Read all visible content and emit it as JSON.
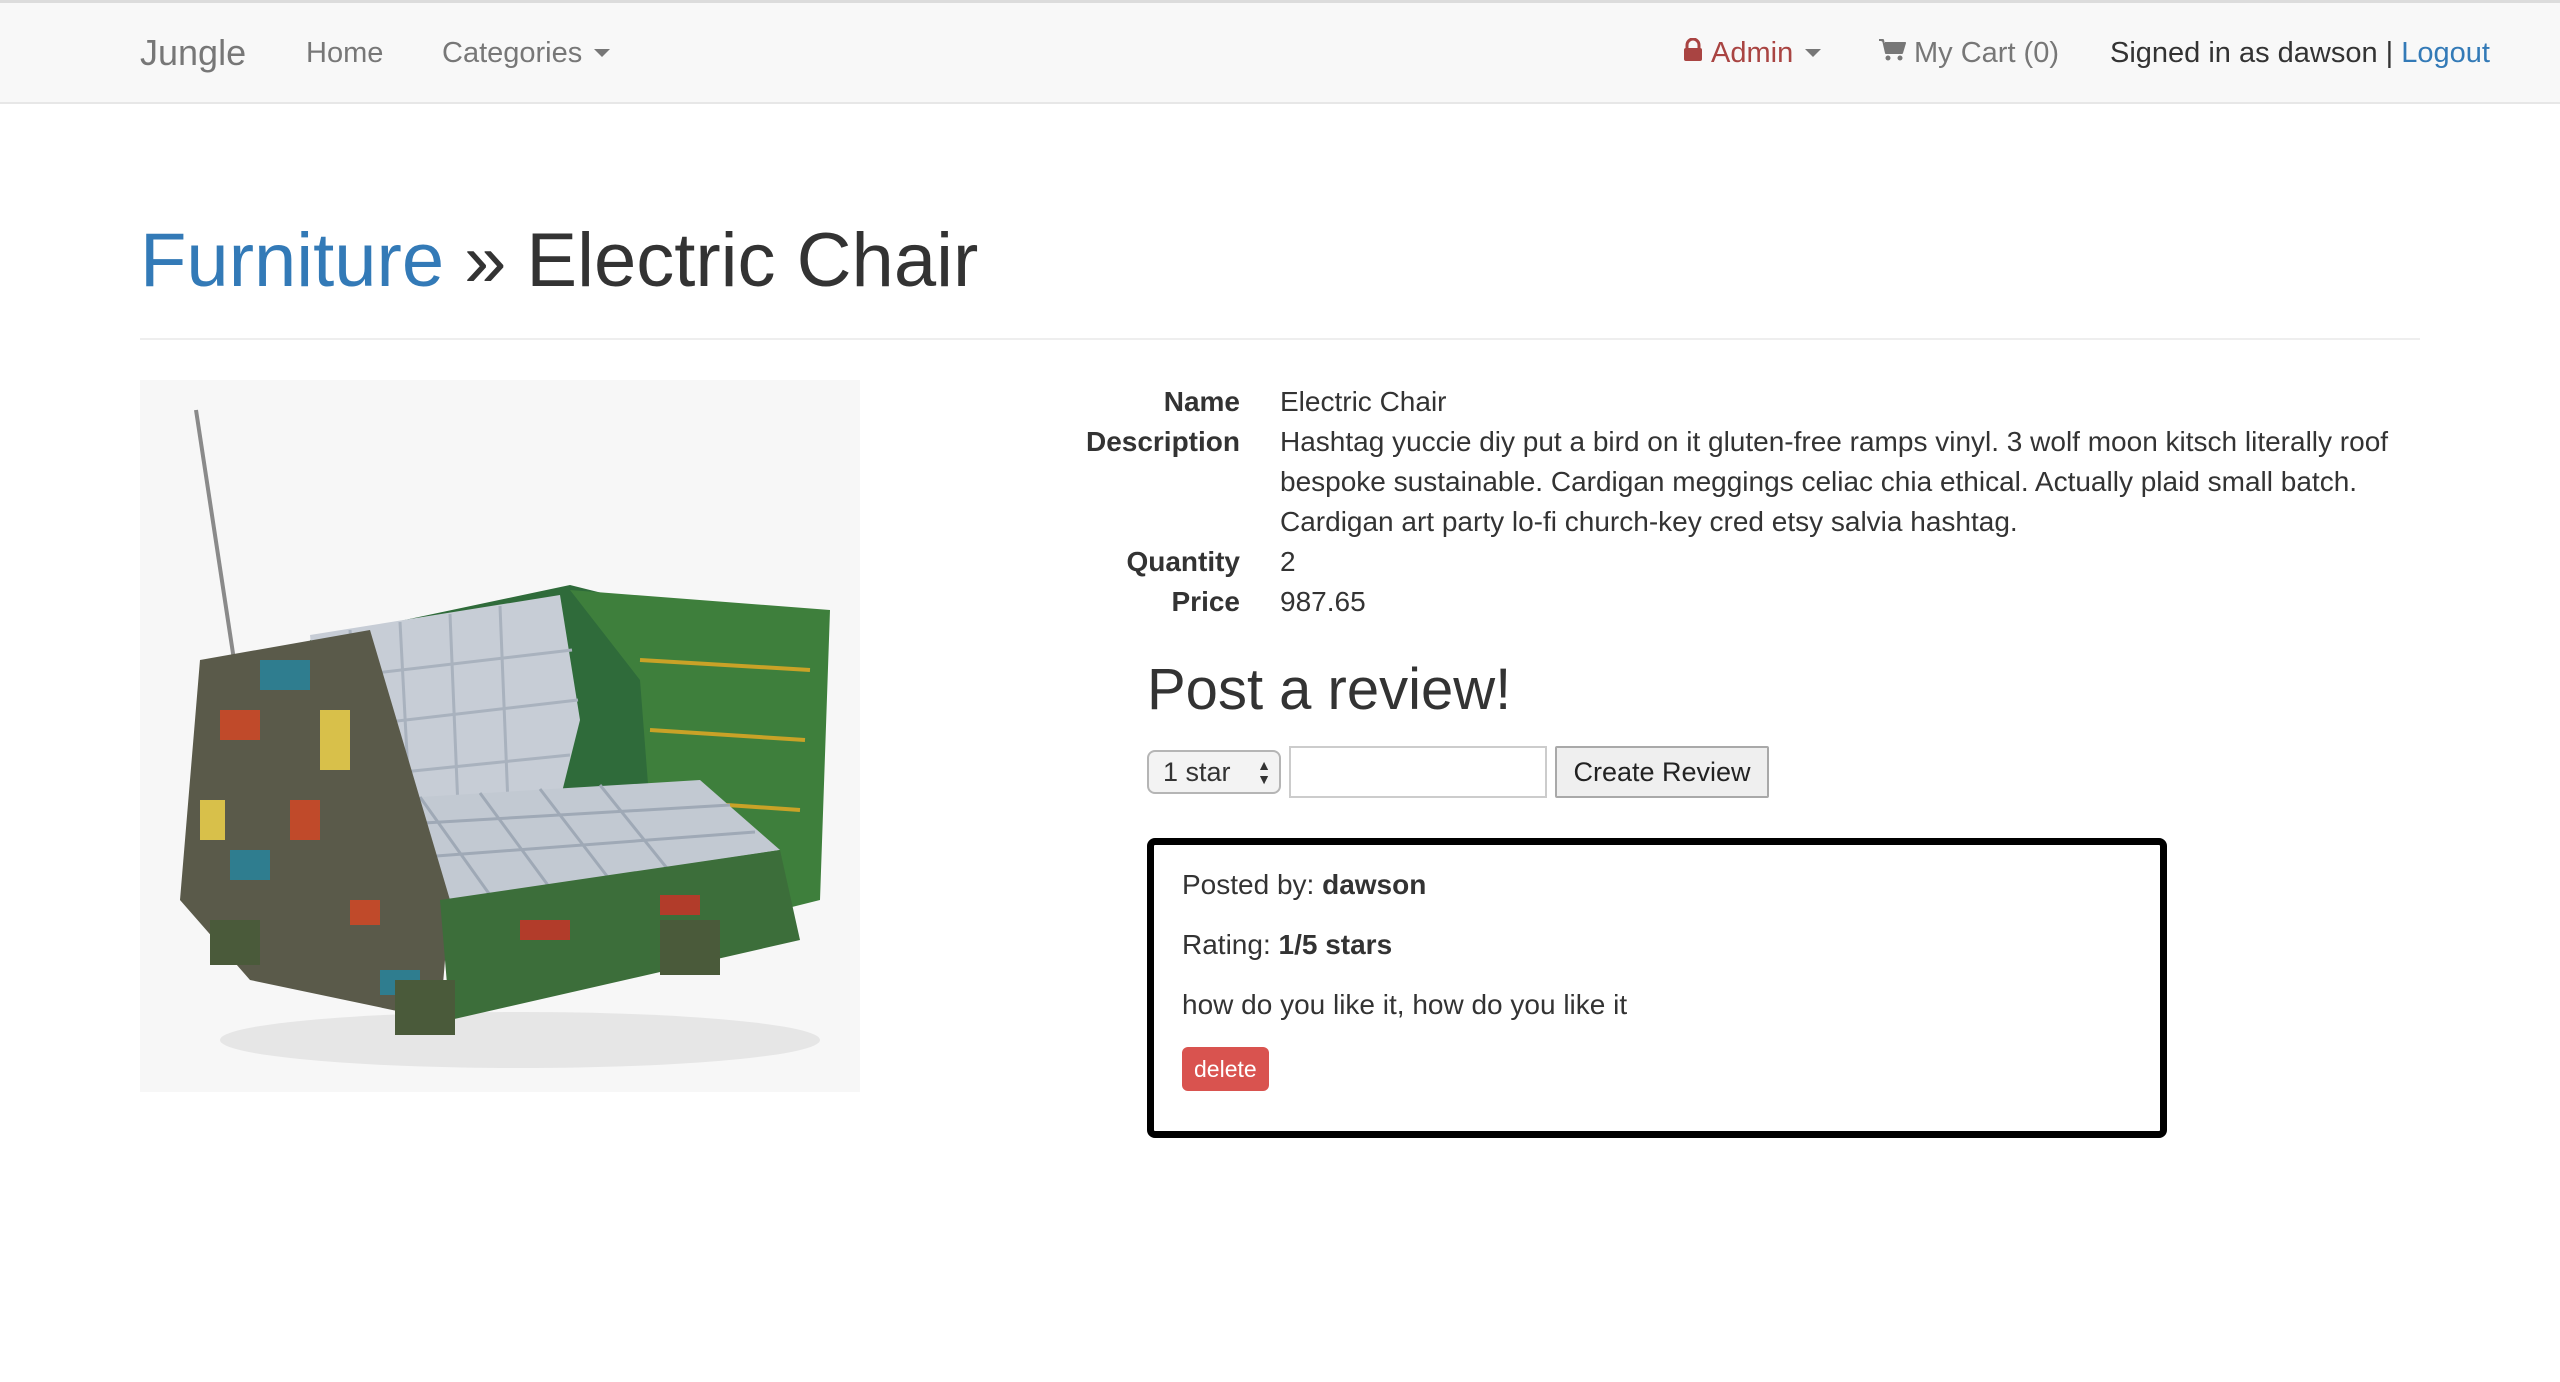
{
  "navbar": {
    "brand": "Jungle",
    "home": "Home",
    "categories": "Categories",
    "admin": "Admin",
    "cart": "My Cart (0)",
    "signed_in": "Signed in as dawson",
    "separator": "|",
    "logout": "Logout",
    "icons": {
      "admin": "lock-icon",
      "cart": "shopping-cart-icon"
    },
    "colors": {
      "admin": "#a94442",
      "link": "#337ab7"
    }
  },
  "header": {
    "category": "Furniture",
    "separator": "»",
    "product": "Electric Chair"
  },
  "product": {
    "image_icon": "electric-chair-image",
    "labels": {
      "name": "Name",
      "description": "Description",
      "quantity": "Quantity",
      "price": "Price"
    },
    "name": "Electric Chair",
    "description": "Hashtag yuccie diy put a bird on it gluten-free ramps vinyl. 3 wolf moon kitsch literally roof bespoke sustainable. Cardigan meggings celiac chia ethical. Actually plaid small batch. Cardigan art party lo-fi church-key cred etsy salvia hashtag.",
    "quantity": "2",
    "price": "987.65"
  },
  "review_form": {
    "title": "Post a review!",
    "rating_selected": "1 star",
    "comment_value": "",
    "submit_label": "Create Review"
  },
  "reviews": [
    {
      "posted_by_label": "Posted by:",
      "author": "dawson",
      "rating_label": "Rating:",
      "rating": "1/5 stars",
      "text": "how do you like it, how do you like it",
      "delete_label": "delete",
      "delete_color": "#d9534f"
    }
  ]
}
